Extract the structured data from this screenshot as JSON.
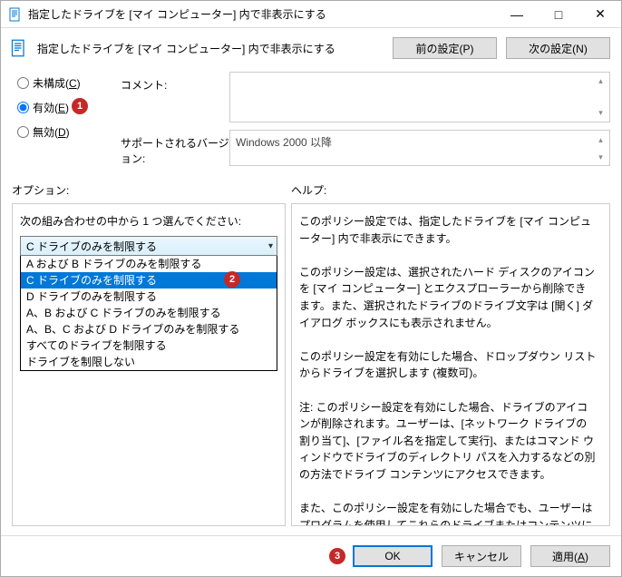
{
  "titlebar": {
    "text": "指定したドライブを [マイ コンピューター] 内で非表示にする"
  },
  "header": {
    "title": "指定したドライブを [マイ コンピューター] 内で非表示にする",
    "prev_btn": "前の設定(P)",
    "next_btn": "次の設定(N)"
  },
  "radios": {
    "not_configured": "未構成(C)",
    "enabled": "有効(E)",
    "disabled": "無効(D)"
  },
  "info": {
    "comment_label": "コメント:",
    "comment_value": "",
    "supported_label": "サポートされるバージョン:",
    "supported_value": "Windows 2000 以降"
  },
  "section_labels": {
    "options": "オプション:",
    "help": "ヘルプ:"
  },
  "options": {
    "instruction": "次の組み合わせの中から 1 つ選んでください:",
    "selected": "C ドライブのみを制限する",
    "items": [
      "A および B ドライブのみを制限する",
      "C ドライブのみを制限する",
      "D ドライブのみを制限する",
      "A、B および C ドライブのみを制限する",
      "A、B、C および D ドライブのみを制限する",
      "すべてのドライブを制限する",
      "ドライブを制限しない"
    ],
    "highlighted_index": 1
  },
  "help_text": "このポリシー設定では、指定したドライブを [マイ コンピューター] 内で非表示にできます。\n\nこのポリシー設定は、選択されたハード ディスクのアイコンを [マイ コンピューター] とエクスプローラーから削除できます。また、選択されたドライブのドライブ文字は [開く] ダイアログ ボックスにも表示されません。\n\nこのポリシー設定を有効にした場合、ドロップダウン リストからドライブを選択します (複数可)。\n\n注: このポリシー設定を有効にした場合、ドライブのアイコンが削除されます。ユーザーは、[ネットワーク ドライブの割り当て]、[ファイル名を指定して実行]、またはコマンド ウィンドウでドライブのディレクトリ パスを入力するなどの別の方法でドライブ コンテンツにアクセスできます。\n\nまた、このポリシー設定を有効にした場合でも、ユーザーはプログラムを使用してこれらのドライブまたはコンテンツにアクセスできます。また、ユーザーがディスクの管理スナップインを使用して、ドライブ文字を表示および変更できなくなることもありません。",
  "footer": {
    "ok": "OK",
    "cancel": "キャンセル",
    "apply": "適用(A)"
  },
  "badges": {
    "b1": "1",
    "b2": "2",
    "b3": "3"
  }
}
